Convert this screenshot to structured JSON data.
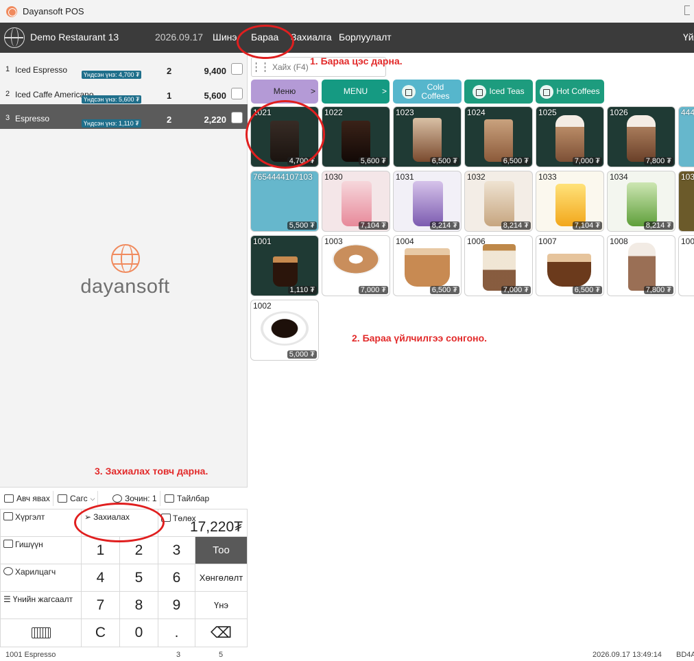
{
  "window": {
    "title": "Dayansoft POS"
  },
  "topbar": {
    "restaurant": "Demo Restaurant 13",
    "date": "2026.09.17",
    "menu": [
      "Шинэ",
      "Бараа",
      "Захиалга",
      "Борлуулалт"
    ],
    "right_text": "Үйл"
  },
  "order": {
    "rows": [
      {
        "num": "1",
        "name": "Iced Espresso",
        "base": "Үндсэн үнэ: 4,700 ₮",
        "qty": "2",
        "total": "9,400"
      },
      {
        "num": "2",
        "name": "Iced Caffe Americano",
        "base": "Үндсэн үнэ: 5,600 ₮",
        "qty": "1",
        "total": "5,600"
      },
      {
        "num": "3",
        "name": "Espresso",
        "base": "Үндсэн үнэ: 1,110 ₮",
        "qty": "2",
        "total": "2,220"
      }
    ],
    "selected_index": 2
  },
  "brand": {
    "name": "dayansoft"
  },
  "actions": {
    "takeaway": "Авч явах",
    "cart": "Сагс",
    "guests": "Зочин: 1",
    "note": "Тайлбар"
  },
  "keypad": {
    "delivery": "Хүргэлт",
    "order": "Захиалах",
    "pay": "Төлөх",
    "total": "17,220₮",
    "member": "Гишүүн",
    "customer": "Харилцагч",
    "pricelist": "Үнийн жагсаалт",
    "qty": "Тоо",
    "discount": "Хөнгөлөлт",
    "price": "Үнэ",
    "keys": [
      "1",
      "2",
      "3",
      "4",
      "5",
      "6",
      "7",
      "8",
      "9",
      "C",
      "0",
      "."
    ]
  },
  "search": {
    "placeholder": "Хайх (F4)"
  },
  "categories": [
    {
      "label": "Меню",
      "arrow": ">",
      "color": "#b49ad6"
    },
    {
      "label": "MENU",
      "arrow": ">",
      "color": "#159a82"
    },
    {
      "label": "Cold Coffees",
      "color": "#56b6cc"
    },
    {
      "label": "Iced Teas",
      "color": "#1d9c7e"
    },
    {
      "label": "Hot Coffees",
      "color": "#1d9c7e"
    }
  ],
  "products": [
    {
      "code": "1021",
      "price": "4,700 ₮"
    },
    {
      "code": "1022",
      "price": "5,600 ₮"
    },
    {
      "code": "1023",
      "price": "6,500 ₮"
    },
    {
      "code": "1024",
      "price": "6,500 ₮"
    },
    {
      "code": "1025",
      "price": "7,000 ₮"
    },
    {
      "code": "1026",
      "price": "7,800 ₮"
    },
    {
      "code": "444",
      "price": ""
    },
    {
      "code": "7654444107103",
      "price": "5,500 ₮"
    },
    {
      "code": "1030",
      "price": "7,104 ₮"
    },
    {
      "code": "1031",
      "price": "8,214 ₮"
    },
    {
      "code": "1032",
      "price": "8,214 ₮"
    },
    {
      "code": "1033",
      "price": "7,104 ₮"
    },
    {
      "code": "1034",
      "price": "8,214 ₮"
    },
    {
      "code": "103",
      "price": ""
    },
    {
      "code": "1001",
      "price": "1,110 ₮"
    },
    {
      "code": "1003",
      "price": "7,000 ₮"
    },
    {
      "code": "1004",
      "price": "6,500 ₮"
    },
    {
      "code": "1006",
      "price": "7,000 ₮"
    },
    {
      "code": "1007",
      "price": "6,500 ₮"
    },
    {
      "code": "1008",
      "price": "7,800 ₮"
    },
    {
      "code": "100",
      "price": ""
    },
    {
      "code": "1002",
      "price": "5,000 ₮"
    }
  ],
  "annotations": {
    "step1": "1. Бараа цэс дарна.",
    "step2": "2. Бараа үйлчилгээ сонгоно.",
    "step3": "3. Захиалах товч дарна."
  },
  "status": {
    "item": "1001 Espresso",
    "a": "3",
    "b": "5",
    "datetime": "2026.09.17 13:49:14",
    "code": "BD4A"
  },
  "colors": {
    "accent_dark": "#3b3b3b",
    "annotation": "#e22a2a",
    "badge": "#1f6f8b"
  }
}
